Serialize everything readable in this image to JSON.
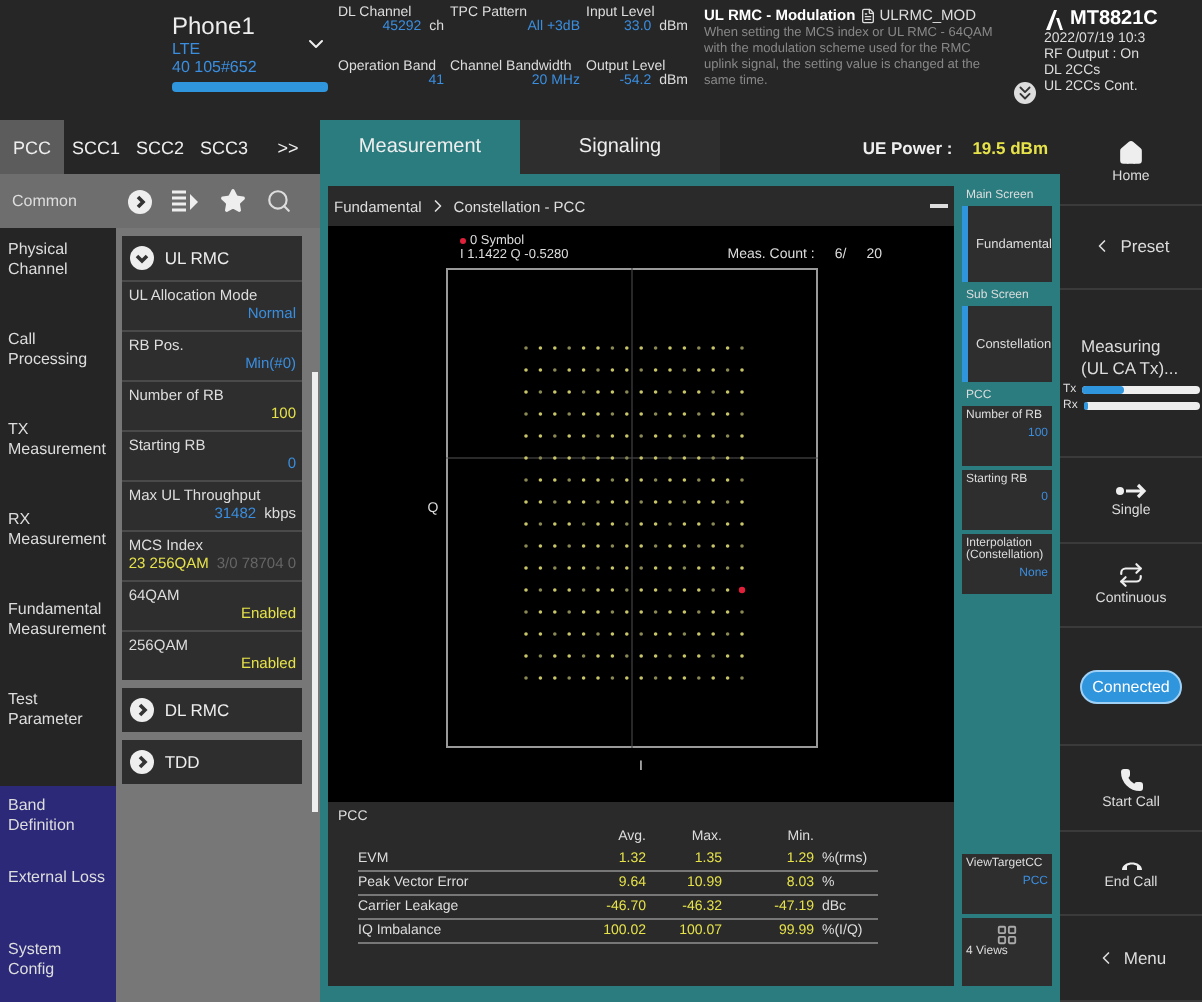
{
  "device": {
    "name": "Phone1",
    "rat": "LTE",
    "id": "40 105#652"
  },
  "params": [
    {
      "label": "DL Channel",
      "value": "45292",
      "unit": "ch"
    },
    {
      "label": "TPC Pattern",
      "value": "All +3dB"
    },
    {
      "label": "Input Level",
      "value": "33.0",
      "unit": "dBm"
    },
    {
      "label": "Operation Band",
      "value": "41"
    },
    {
      "label": "Channel Bandwidth",
      "value": "20 MHz"
    },
    {
      "label": "Output Level",
      "value": "-54.2",
      "unit": "dBm"
    }
  ],
  "notice": {
    "title": "UL RMC - Modulation",
    "code": "ULRMC_MOD",
    "message": "When setting the MCS index or UL RMC - 64QAM with the modulation scheme used for the RMC uplink signal, the setting value is changed at the same time."
  },
  "instrument": {
    "model": "MT8821C",
    "date": "2022/07/19 10:3",
    "lines": [
      "RF Output : On",
      "DL 2CCs",
      "UL 2CCs Cont."
    ]
  },
  "cc_tabs": [
    {
      "label": "PCC",
      "selected": true
    },
    {
      "label": "SCC1",
      "selected": false
    },
    {
      "label": "SCC2",
      "selected": false
    },
    {
      "label": "SCC3",
      "selected": false
    },
    {
      "label": ">>",
      "selected": false
    }
  ],
  "toolbar": {
    "label": "Common"
  },
  "nav": [
    "Physical Channel",
    "Call Processing",
    "TX Measurement",
    "RX Measurement",
    "Fundamental Measurement",
    "Test Parameter"
  ],
  "system_nav": [
    "Band Definition",
    "External Loss",
    "System Config"
  ],
  "settings": [
    {
      "title": "UL RMC",
      "expanded": true,
      "params": [
        {
          "label": "UL Allocation Mode",
          "value": "Normal",
          "color": "#3a8ee0"
        },
        {
          "label": "RB Pos.",
          "value": "Min(#0)",
          "color": "#3a8ee0"
        },
        {
          "label": "Number of RB",
          "value": "100",
          "color": "#e6e24a"
        },
        {
          "label": "Starting RB",
          "value": "0",
          "color": "#3a8ee0"
        },
        {
          "label": "Max UL Throughput",
          "value": "31482",
          "unit": "kbps",
          "color": "#3a8ee0"
        },
        {
          "label": "MCS Index",
          "value": "23  256QAM",
          "extra": "3/0 78704 0",
          "color": "#e6e24a"
        },
        {
          "label": "64QAM",
          "value": "Enabled",
          "color": "#e6e24a"
        },
        {
          "label": "256QAM",
          "value": "Enabled",
          "color": "#e6e24a"
        }
      ]
    },
    {
      "title": "DL RMC",
      "expanded": false
    },
    {
      "title": "TDD",
      "expanded": false
    }
  ],
  "view_tabs": [
    {
      "label": "Measurement",
      "selected": true
    },
    {
      "label": "Signaling",
      "selected": false
    }
  ],
  "ue_power": {
    "label": "UE Power :",
    "value": "19.5 dBm"
  },
  "breadcrumb": [
    "Fundamental",
    "Constellation - PCC"
  ],
  "plot": {
    "symbol": "0 Symbol",
    "readout": "I 1.1422 Q -0.5280",
    "count_label": "Meas. Count :",
    "count": "6/",
    "total": "20",
    "y_axis": "Q",
    "x_axis": "I"
  },
  "results": {
    "title": "PCC",
    "columns": [
      "Avg.",
      "Max.",
      "Min."
    ],
    "rows": [
      {
        "name": "EVM",
        "values": [
          "1.32",
          "1.35",
          "1.29"
        ],
        "unit": "%(rms)"
      },
      {
        "name": "Peak Vector Error",
        "values": [
          "9.64",
          "10.99",
          "8.03"
        ],
        "unit": "%"
      },
      {
        "name": "Carrier Leakage",
        "values": [
          "-46.70",
          "-46.32",
          "-47.19"
        ],
        "unit": "dBc"
      },
      {
        "name": "IQ Imbalance",
        "values": [
          "100.02",
          "100.07",
          "99.99"
        ],
        "unit": "%(I/Q)"
      }
    ]
  },
  "side_panel": [
    {
      "kind": "heading",
      "label": "Main Screen"
    },
    {
      "kind": "button",
      "label": "Fundamental",
      "selected": true
    },
    {
      "kind": "heading",
      "label": "Sub Screen"
    },
    {
      "kind": "button",
      "label": "Constellation",
      "selected": true
    },
    {
      "kind": "heading",
      "label": "PCC"
    },
    {
      "kind": "setting",
      "label": "Number of RB",
      "value": "100"
    },
    {
      "kind": "setting",
      "label": "Starting RB",
      "value": "0"
    },
    {
      "kind": "setting",
      "label": "Interpolation (Constellation)",
      "value": "None"
    }
  ],
  "side_bottom": [
    {
      "kind": "setting",
      "label": "ViewTargetCC",
      "value": "PCC"
    },
    {
      "kind": "views",
      "label": "4 Views"
    }
  ],
  "actions": [
    {
      "kind": "home",
      "label": "Home"
    },
    {
      "kind": "back",
      "label": "Preset"
    },
    {
      "kind": "status",
      "label": "Measuring (UL CA Tx)...",
      "meters": [
        {
          "label": "Tx",
          "level": 0.35
        },
        {
          "label": "Rx",
          "level": 0.04
        }
      ]
    },
    {
      "kind": "single",
      "label": "Single"
    },
    {
      "kind": "continuous",
      "label": "Continuous"
    },
    {
      "kind": "pill",
      "label": "Connected"
    },
    {
      "kind": "start_call",
      "label": "Start Call"
    },
    {
      "kind": "end_call",
      "label": "End Call"
    },
    {
      "kind": "back",
      "label": "Menu"
    }
  ]
}
